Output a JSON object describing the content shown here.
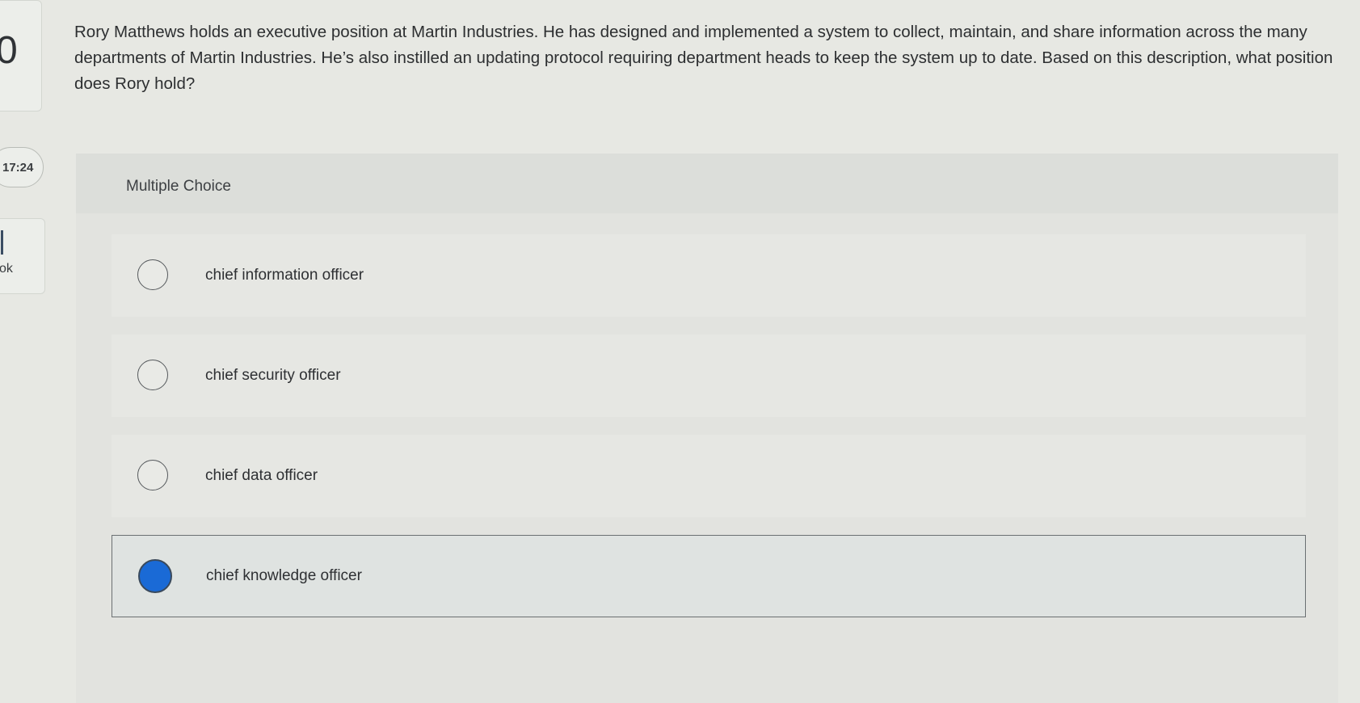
{
  "sidebar": {
    "top_number": "0",
    "timer": "17:24",
    "book_label": "ok"
  },
  "question": {
    "text": "Rory Matthews holds an executive position at Martin Industries. He has designed and implemented a system to collect, maintain, and share information across the many departments of Martin Industries. He’s also instilled an updating protocol requiring department heads to keep the system up to date. Based on this description, what position does Rory hold?"
  },
  "answers": {
    "type_label": "Multiple Choice",
    "options": [
      {
        "label": "chief information officer",
        "selected": false
      },
      {
        "label": "chief security officer",
        "selected": false
      },
      {
        "label": "chief data officer",
        "selected": false
      },
      {
        "label": "chief knowledge officer",
        "selected": true
      }
    ],
    "selected_color": "#1a6ad6"
  }
}
